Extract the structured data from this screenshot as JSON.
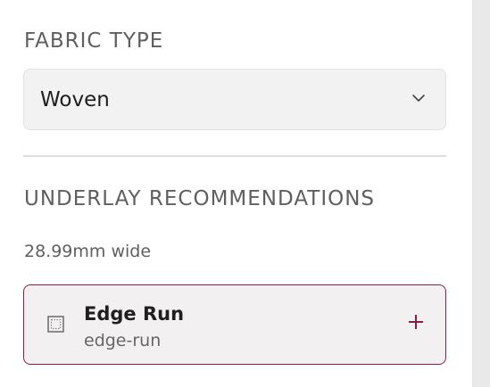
{
  "fabric": {
    "heading": "FABRIC TYPE",
    "selected_value": "Woven"
  },
  "underlay": {
    "heading": "UNDERLAY RECOMMENDATIONS",
    "width_note": "28.99mm wide",
    "recommendation": {
      "title": "Edge Run",
      "subtitle": "edge-run",
      "icon": "dotted-square-icon",
      "action_icon": "plus-icon"
    }
  },
  "colors": {
    "accent": "#8a1e3f",
    "heading_text": "#5f5f5f",
    "select_background": "#f2f2f2",
    "card_background": "#f3f0f1"
  }
}
